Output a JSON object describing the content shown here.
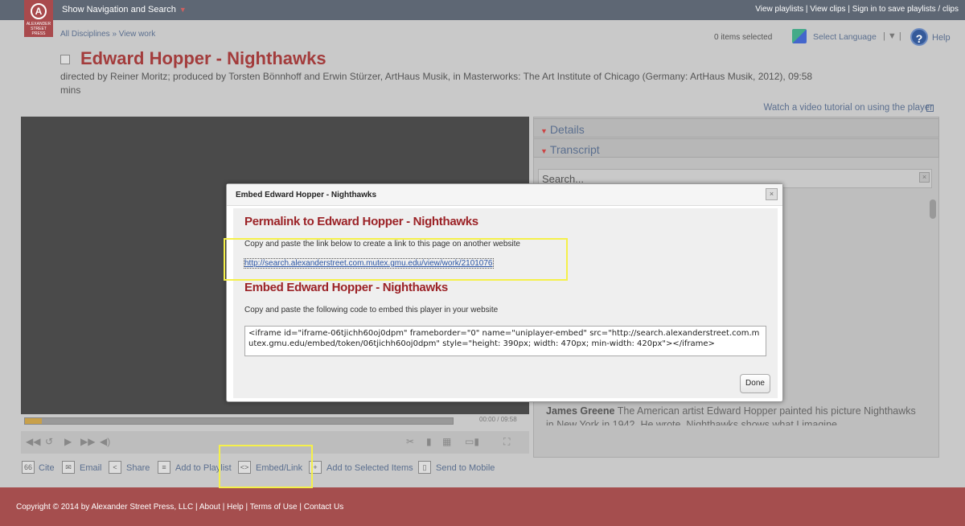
{
  "topbar": {
    "logo_text": "ALEXANDER STREET PRESS",
    "nav_toggle": "Show Navigation and Search",
    "links": "View playlists | View clips | Sign in to save playlists / clips"
  },
  "header": {
    "breadcrumb": "All Disciplines » View work",
    "items_selected": "0 items selected",
    "select_language": "Select Language",
    "help": "Help"
  },
  "work": {
    "title": "Edward Hopper - Nighthawks",
    "subtitle": "directed by Reiner Moritz; produced by Torsten Bönnhoff and Erwin Stürzer, ArtHaus Musik, in Masterworks: The Art Institute of Chicago (Germany: ArtHaus Musik, 2012), 09:58 mins",
    "tutorial_link": "Watch a video tutorial on using the player"
  },
  "player": {
    "time": "00:00 / 09:58",
    "progress": 0.04
  },
  "tools": {
    "cite": "Cite",
    "email": "Email",
    "share": "Share",
    "add_playlist": "Add to Playlist",
    "embed": "Embed/Link",
    "add_selected": "Add to Selected Items",
    "send_mobile": "Send to Mobile"
  },
  "side": {
    "details_tab": "Details",
    "transcript_tab": "Transcript",
    "search_placeholder": "Search...",
    "transcript_speaker": "James Greene",
    "transcript_text": " The American artist Edward Hopper painted his picture Nighthawks in New York in 1942. He wrote, Nighthawks shows what I imagine"
  },
  "modal": {
    "title": "Embed Edward Hopper - Nighthawks",
    "permalink_heading": "Permalink to Edward Hopper - Nighthawks",
    "permalink_instructions": "Copy and paste the link below to create a link to this page on another website",
    "permalink_url": "http://search.alexanderstreet.com.mutex.gmu.edu/view/work/2101076",
    "embed_heading": "Embed Edward Hopper - Nighthawks",
    "embed_instructions": "Copy and paste the following code to embed this player in your website",
    "embed_code": "<iframe id=\"iframe-06tjichh60oj0dpm\" frameborder=\"0\" name=\"uniplayer-embed\" src=\"http://search.alexanderstreet.com.mutex.gmu.edu/embed/token/06tjichh60oj0dpm\" style=\"height: 390px; width: 470px; min-width: 420px\"></iframe>",
    "done": "Done"
  },
  "footer": {
    "text": "Copyright © 2014 by Alexander Street Press, LLC | About | Help | Terms of Use | Contact Us"
  },
  "colors": {
    "title_red": "#a33c3c",
    "modal_heading": "#9b2226",
    "link_blue": "#2a55a5",
    "highlight": "#f5f04a",
    "footer": "#a54e4e"
  }
}
